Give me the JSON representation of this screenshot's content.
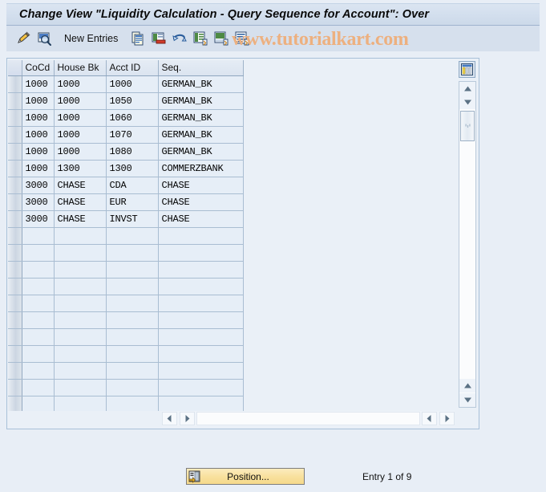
{
  "window": {
    "title": "Change View \"Liquidity Calculation - Query Sequence for Account\": Over"
  },
  "watermark": {
    "text": "www.tutorialkart.com",
    "color": "#edb07f"
  },
  "toolbar": {
    "items": [
      {
        "name": "change-mode-icon",
        "label": "",
        "icon": "pencil-icon"
      },
      {
        "name": "display-mode-icon",
        "label": "",
        "icon": "magnifier-icon"
      },
      {
        "name": "new-entries-button",
        "label": "New Entries",
        "icon": ""
      },
      {
        "name": "copy-icon",
        "label": "",
        "icon": "copy-icon"
      },
      {
        "name": "delete-icon",
        "label": "",
        "icon": "delete-icon"
      },
      {
        "name": "undo-icon",
        "label": "",
        "icon": "undo-icon"
      },
      {
        "name": "select-all-icon",
        "label": "",
        "icon": "select-all-icon"
      },
      {
        "name": "deselect-all-icon",
        "label": "",
        "icon": "deselect-all-icon"
      },
      {
        "name": "select-block-icon",
        "label": "",
        "icon": "select-block-icon"
      }
    ]
  },
  "table": {
    "columns": [
      "CoCd",
      "House Bk",
      "Acct ID",
      "Seq."
    ],
    "rows": [
      [
        "1000",
        "1000",
        "1000",
        "GERMAN_BK"
      ],
      [
        "1000",
        "1000",
        "1050",
        "GERMAN_BK"
      ],
      [
        "1000",
        "1000",
        "1060",
        "GERMAN_BK"
      ],
      [
        "1000",
        "1000",
        "1070",
        "GERMAN_BK"
      ],
      [
        "1000",
        "1000",
        "1080",
        "GERMAN_BK"
      ],
      [
        "1000",
        "1300",
        "1300",
        "COMMERZBANK"
      ],
      [
        "3000",
        "CHASE",
        "CDA",
        "CHASE"
      ],
      [
        "3000",
        "CHASE",
        "EUR",
        "CHASE"
      ],
      [
        "3000",
        "CHASE",
        "INVST",
        "CHASE"
      ]
    ],
    "empty_row_count": 11
  },
  "footer": {
    "position_button_label": "Position...",
    "entry_status": "Entry 1 of 9"
  },
  "colors": {
    "background": "#e8eef6",
    "panel": "#eaf0f7",
    "row": "#e6eef7",
    "header": "#dbe4f0",
    "accent_button": "#f8e09c"
  }
}
